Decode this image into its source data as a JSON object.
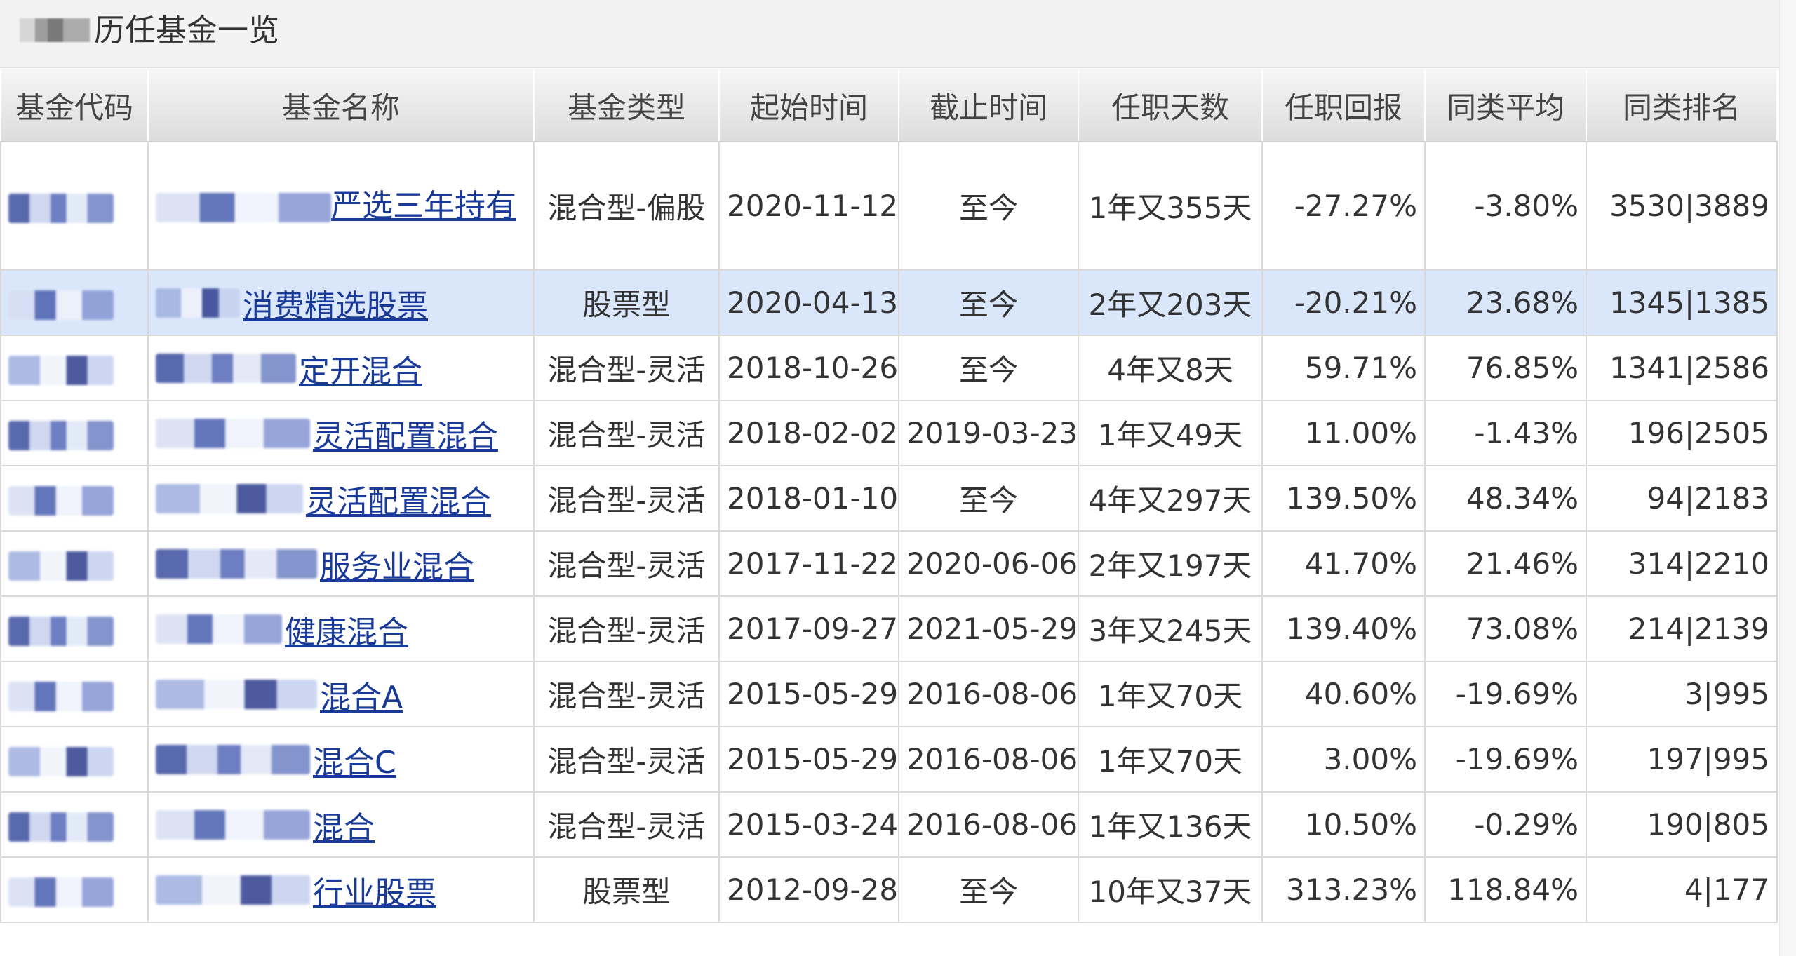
{
  "title": "历任基金一览",
  "columns": [
    "基金代码",
    "基金名称",
    "基金类型",
    "起始时间",
    "截止时间",
    "任职天数",
    "任职回报",
    "同类平均",
    "同类排名"
  ],
  "rows": [
    {
      "name": "严选三年持有",
      "type": "混合型-偏股",
      "start": "2020-11-12",
      "end": "至今",
      "days": "1年又355天",
      "ret": "-27.27%",
      "ret_sign": "neg",
      "avg": "-3.80%",
      "avg_sign": "neg",
      "rank": "3530|3889"
    },
    {
      "name": "消费精选股票",
      "type": "股票型",
      "start": "2020-04-13",
      "end": "至今",
      "days": "2年又203天",
      "ret": "-20.21%",
      "ret_sign": "neg",
      "avg": "23.68%",
      "avg_sign": "pos",
      "rank": "1345|1385"
    },
    {
      "name": "定开混合",
      "type": "混合型-灵活",
      "start": "2018-10-26",
      "end": "至今",
      "days": "4年又8天",
      "ret": "59.71%",
      "ret_sign": "pos",
      "avg": "76.85%",
      "avg_sign": "pos",
      "rank": "1341|2586"
    },
    {
      "name": "灵活配置混合",
      "type": "混合型-灵活",
      "start": "2018-02-02",
      "end": "2019-03-23",
      "days": "1年又49天",
      "ret": "11.00%",
      "ret_sign": "pos",
      "avg": "-1.43%",
      "avg_sign": "neg",
      "rank": "196|2505"
    },
    {
      "name": "灵活配置混合",
      "type": "混合型-灵活",
      "start": "2018-01-10",
      "end": "至今",
      "days": "4年又297天",
      "ret": "139.50%",
      "ret_sign": "pos",
      "avg": "48.34%",
      "avg_sign": "pos",
      "rank": "94|2183"
    },
    {
      "name": "服务业混合",
      "type": "混合型-灵活",
      "start": "2017-11-22",
      "end": "2020-06-06",
      "days": "2年又197天",
      "ret": "41.70%",
      "ret_sign": "pos",
      "avg": "21.46%",
      "avg_sign": "pos",
      "rank": "314|2210"
    },
    {
      "name": "健康混合",
      "type": "混合型-灵活",
      "start": "2017-09-27",
      "end": "2021-05-29",
      "days": "3年又245天",
      "ret": "139.40%",
      "ret_sign": "pos",
      "avg": "73.08%",
      "avg_sign": "pos",
      "rank": "214|2139"
    },
    {
      "name": "混合A",
      "type": "混合型-灵活",
      "start": "2015-05-29",
      "end": "2016-08-06",
      "days": "1年又70天",
      "ret": "40.60%",
      "ret_sign": "pos",
      "avg": "-19.69%",
      "avg_sign": "neg",
      "rank": "3|995"
    },
    {
      "name": "混合C",
      "type": "混合型-灵活",
      "start": "2015-05-29",
      "end": "2016-08-06",
      "days": "1年又70天",
      "ret": "3.00%",
      "ret_sign": "pos",
      "avg": "-19.69%",
      "avg_sign": "neg",
      "rank": "197|995"
    },
    {
      "name": "混合",
      "type": "混合型-灵活",
      "start": "2015-03-24",
      "end": "2016-08-06",
      "days": "1年又136天",
      "ret": "10.50%",
      "ret_sign": "pos",
      "avg": "-0.29%",
      "avg_sign": "neg",
      "rank": "190|805"
    },
    {
      "name": "行业股票",
      "type": "股票型",
      "start": "2012-09-28",
      "end": "至今",
      "days": "10年又37天",
      "ret": "313.23%",
      "ret_sign": "pos",
      "avg": "118.84%",
      "avg_sign": "pos",
      "rank": "4|177"
    }
  ],
  "selected_row": 1,
  "colors": {
    "positive": "#d40000",
    "negative": "#138a13",
    "link": "#1a3a9a",
    "selected_bg": "#dae7fb"
  }
}
